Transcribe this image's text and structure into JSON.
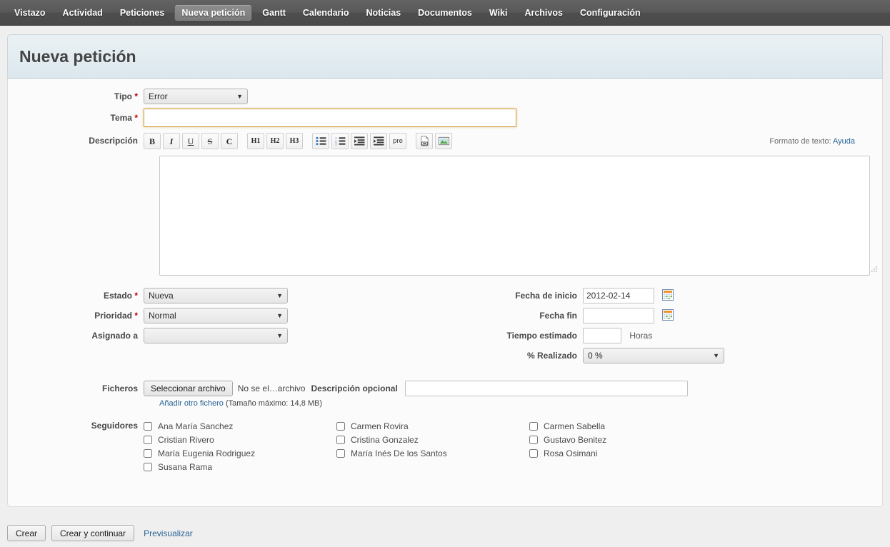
{
  "nav": {
    "items": [
      {
        "label": "Vistazo",
        "active": false
      },
      {
        "label": "Actividad",
        "active": false
      },
      {
        "label": "Peticiones",
        "active": false
      },
      {
        "label": "Nueva petición",
        "active": true
      },
      {
        "label": "Gantt",
        "active": false
      },
      {
        "label": "Calendario",
        "active": false
      },
      {
        "label": "Noticias",
        "active": false
      },
      {
        "label": "Documentos",
        "active": false
      },
      {
        "label": "Wiki",
        "active": false
      },
      {
        "label": "Archivos",
        "active": false
      },
      {
        "label": "Configuración",
        "active": false
      }
    ]
  },
  "page": {
    "title": "Nueva petición"
  },
  "form": {
    "tipo": {
      "label": "Tipo",
      "required": "*",
      "value": "Error"
    },
    "tema": {
      "label": "Tema",
      "required": "*",
      "value": "",
      "placeholder": ""
    },
    "descripcion": {
      "label": "Descripción",
      "value": "",
      "placeholder": ""
    },
    "formato": {
      "prefix": "Formato de texto:",
      "link": "Ayuda"
    },
    "toolbar": [
      {
        "name": "bold",
        "glyph": "B",
        "cls": "b"
      },
      {
        "name": "italic",
        "glyph": "I",
        "cls": "i"
      },
      {
        "name": "underline",
        "glyph": "U",
        "cls": "u"
      },
      {
        "name": "strikethrough",
        "glyph": "S",
        "cls": "s"
      },
      {
        "name": "code",
        "glyph": "C",
        "cls": "c"
      },
      {
        "name": "heading-1",
        "glyph": "H1",
        "cls": "hx"
      },
      {
        "name": "heading-2",
        "glyph": "H2",
        "cls": "hx"
      },
      {
        "name": "heading-3",
        "glyph": "H3",
        "cls": "hx"
      },
      {
        "name": "unordered-list",
        "glyph": "",
        "cls": "ul"
      },
      {
        "name": "ordered-list",
        "glyph": "",
        "cls": "ol"
      },
      {
        "name": "indent-decrease",
        "glyph": "",
        "cls": "ind1"
      },
      {
        "name": "indent-increase",
        "glyph": "",
        "cls": "ind2"
      },
      {
        "name": "preformatted",
        "glyph": "pre",
        "cls": "pre"
      },
      {
        "name": "insert-link",
        "glyph": "",
        "cls": "link"
      },
      {
        "name": "insert-image",
        "glyph": "",
        "cls": "img"
      }
    ],
    "estado": {
      "label": "Estado",
      "required": "*",
      "value": "Nueva"
    },
    "prioridad": {
      "label": "Prioridad",
      "required": "*",
      "value": "Normal"
    },
    "asignado": {
      "label": "Asignado a",
      "required": "",
      "value": ""
    },
    "fecha_inicio": {
      "label": "Fecha de inicio",
      "value": "2012-02-14"
    },
    "fecha_fin": {
      "label": "Fecha fin",
      "value": ""
    },
    "tiempo_estimado": {
      "label": "Tiempo estimado",
      "value": "",
      "unit": "Horas"
    },
    "realizado": {
      "label": "% Realizado",
      "value": "0 %"
    },
    "ficheros": {
      "label": "Ficheros",
      "button": "Seleccionar archivo",
      "filename": "No se el…archivo",
      "desc_label": "Descripción opcional",
      "desc_value": "",
      "add_link": "Añadir otro fichero",
      "size_note": "(Tamaño máximo: 14,8 MB)"
    },
    "seguidores": {
      "label": "Seguidores",
      "columns": [
        [
          {
            "name": "Ana María Sanchez",
            "checked": false
          },
          {
            "name": "Cristian Rivero",
            "checked": false
          },
          {
            "name": "María Eugenia Rodriguez",
            "checked": false
          },
          {
            "name": "Susana Rama",
            "checked": false
          }
        ],
        [
          {
            "name": "Carmen Rovira",
            "checked": false
          },
          {
            "name": "Cristina Gonzalez",
            "checked": false
          },
          {
            "name": "María Inés De los Santos",
            "checked": false
          }
        ],
        [
          {
            "name": "Carmen Sabella",
            "checked": false
          },
          {
            "name": "Gustavo Benitez",
            "checked": false
          },
          {
            "name": "Rosa Osimani",
            "checked": false
          }
        ]
      ]
    }
  },
  "actions": {
    "crear": "Crear",
    "crear_continuar": "Crear y continuar",
    "previsualizar": "Previsualizar"
  },
  "colors": {
    "nav_bg": "#4e4e4e",
    "title_bg": "#e2ebf0",
    "link": "#2a6496",
    "required": "#bb0000",
    "focus_border": "#cc9933"
  }
}
